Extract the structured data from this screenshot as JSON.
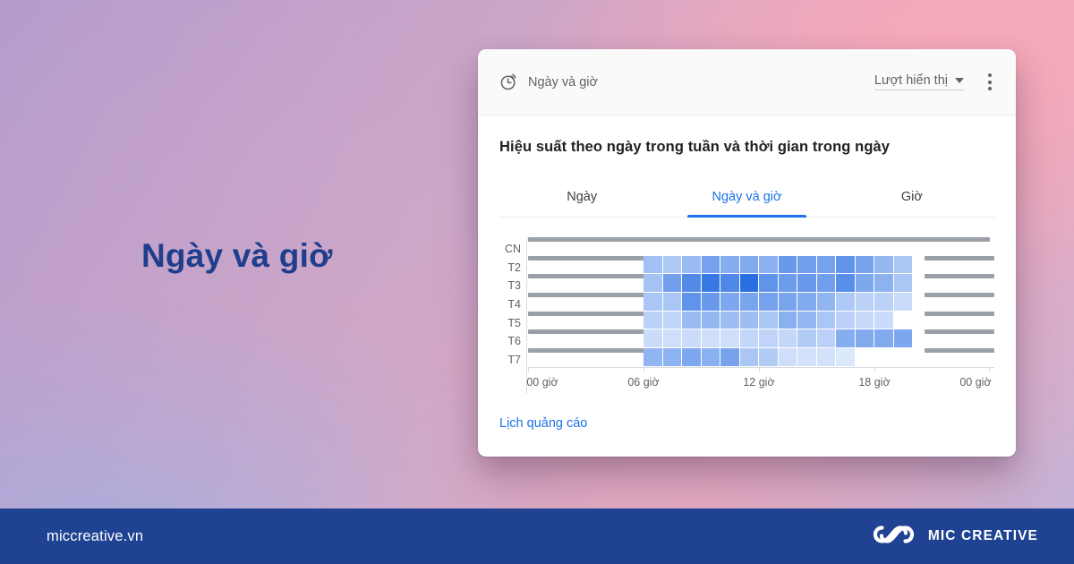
{
  "banner": {
    "headline": "Ngày và giờ",
    "headline_color": "#1f3e8c"
  },
  "card": {
    "header": {
      "icon": "clock-icon",
      "title": "Ngày và giờ",
      "metric_selected": "Lượt hiển thị",
      "metric_caret_icon": "chevron-down-icon",
      "overflow_icon": "kebab-menu-icon"
    },
    "chart_title": "Hiệu suất theo ngày trong tuần và thời gian trong ngày",
    "tabs": [
      {
        "label": "Ngày",
        "active": false
      },
      {
        "label": "Ngày và giờ",
        "active": true
      },
      {
        "label": "Giờ",
        "active": false
      }
    ],
    "active_tab_color": "#1a73e8",
    "footer_link": "Lịch quảng cáo"
  },
  "chart_data": {
    "type": "heatmap",
    "title": "Hiệu suất theo ngày trong tuần và thời gian trong ngày",
    "metric": "Lượt hiển thị",
    "xlabel": "",
    "ylabel": "",
    "grid": false,
    "legend": "none",
    "x_tick_labels": [
      "00 giờ",
      "06 giờ",
      "12 giờ",
      "18 giờ",
      "00 giờ"
    ],
    "x_tick_hours": [
      0,
      6,
      12,
      18,
      24
    ],
    "xlim": [
      0,
      24
    ],
    "categories_y": [
      "CN",
      "T2",
      "T3",
      "T4",
      "T5",
      "T6",
      "T7"
    ],
    "cell_hours": [
      6.5,
      7.5,
      8.5,
      9.5,
      10.5,
      11.5,
      12.5,
      13.5,
      14.5,
      15.5,
      16.5,
      17.5,
      18.5,
      19.5
    ],
    "value_scale": [
      0,
      1
    ],
    "color_empty": "#9aa0a6",
    "color_ramp_low": "#e8f0fe",
    "color_ramp_high": "#1a64e0",
    "series": [
      {
        "name": "CN",
        "values": [
          null,
          null,
          null,
          null,
          null,
          null,
          null,
          null,
          null,
          null,
          null,
          null,
          null,
          null
        ]
      },
      {
        "name": "T2",
        "values": [
          0.34,
          0.28,
          0.38,
          0.55,
          0.48,
          0.5,
          0.45,
          0.62,
          0.58,
          0.56,
          0.66,
          0.55,
          0.4,
          0.3
        ]
      },
      {
        "name": "T3",
        "values": [
          0.33,
          0.58,
          0.72,
          0.86,
          0.74,
          0.92,
          0.66,
          0.6,
          0.62,
          0.58,
          0.7,
          0.52,
          0.44,
          0.3
        ]
      },
      {
        "name": "T4",
        "values": [
          0.3,
          0.3,
          0.66,
          0.62,
          0.52,
          0.54,
          0.56,
          0.54,
          0.5,
          0.42,
          0.28,
          0.22,
          0.22,
          0.15
        ]
      },
      {
        "name": "T5",
        "values": [
          0.22,
          0.2,
          0.38,
          0.4,
          0.36,
          0.36,
          0.3,
          0.46,
          0.4,
          0.3,
          0.22,
          0.16,
          0.14,
          0.0
        ]
      },
      {
        "name": "T6",
        "values": [
          0.14,
          0.12,
          0.14,
          0.12,
          0.12,
          0.18,
          0.2,
          0.18,
          0.26,
          0.22,
          0.48,
          0.5,
          0.5,
          0.52
        ]
      },
      {
        "name": "T7",
        "values": [
          0.42,
          0.44,
          0.52,
          0.46,
          0.55,
          0.3,
          0.26,
          0.12,
          0.1,
          0.1,
          0.06,
          0.0,
          0.0,
          0.0
        ]
      }
    ],
    "no_data_bars": {
      "left_span_hours": [
        0,
        6.4
      ],
      "right_span_hours": [
        20.6,
        24
      ],
      "full_row": "CN"
    }
  },
  "brandbar": {
    "site": "miccreative.vn",
    "logo_icon": "infinity-logo-icon",
    "name": "MIC CREATIVE",
    "background": "#1f4292"
  }
}
